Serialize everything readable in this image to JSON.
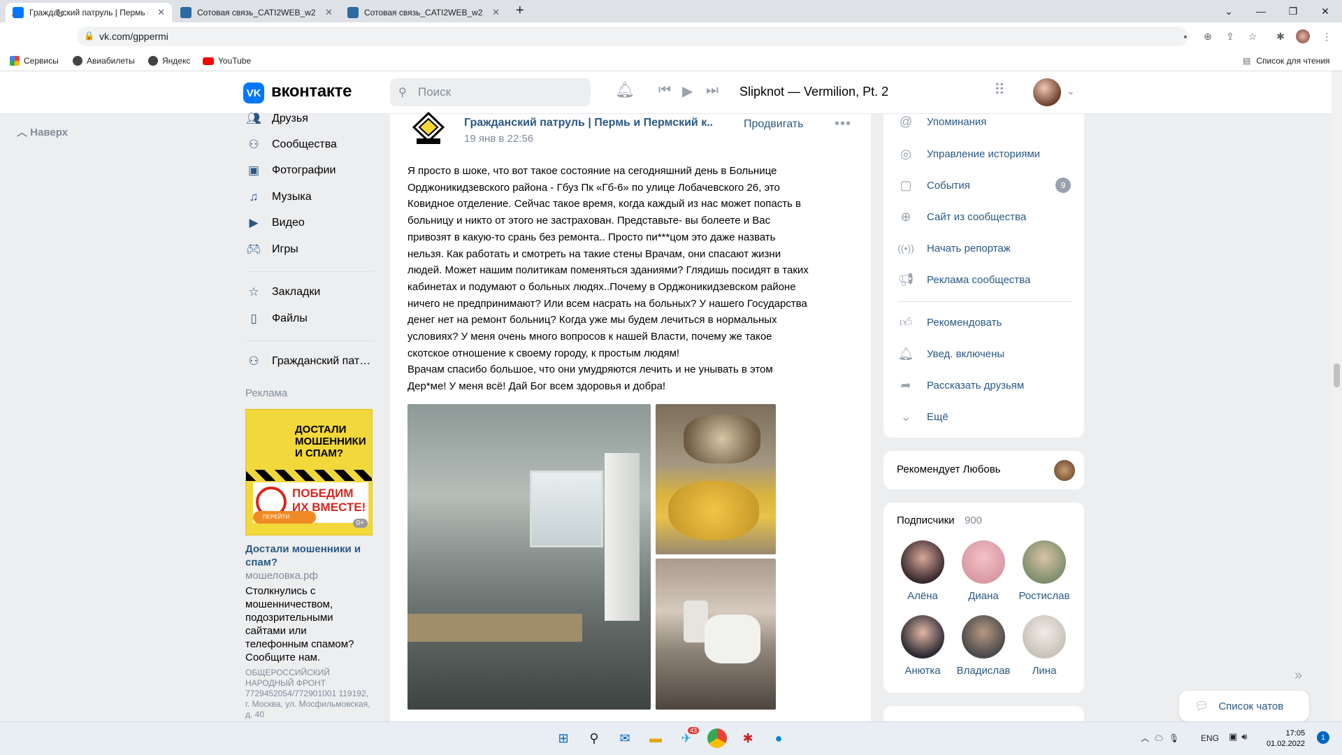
{
  "browser": {
    "tabs": [
      {
        "label": "Гражданский патруль | Пермь и",
        "active": true,
        "favicon_color": "#0077ff"
      },
      {
        "label": "Сотовая связь_CATI2WEB_w2",
        "active": false,
        "favicon_color": "#2d6a9f"
      },
      {
        "label": "Сотовая связь_CATI2WEB_w2",
        "active": false,
        "favicon_color": "#2d6a9f"
      }
    ],
    "new_tab": "+",
    "window_controls": {
      "dropdown": "⌄",
      "minimize": "—",
      "maximize": "❐",
      "close": "✕"
    },
    "url": "vk.com/gppermi",
    "bookmarks": [
      {
        "label": "Сервисы"
      },
      {
        "label": "Авиабилеты"
      },
      {
        "label": "Яндекс"
      },
      {
        "label": "YouTube"
      }
    ],
    "reading_list": "Список для чтения"
  },
  "vk_header": {
    "logo": "VK",
    "brand": "вконтакте",
    "search_placeholder": "Поиск",
    "now_playing": "Slipknot — Vermilion, Pt. 2"
  },
  "left": {
    "back_to_top": "Наверх",
    "menu": [
      {
        "label": "Друзья",
        "icon": "friends-icon"
      },
      {
        "label": "Сообщества",
        "icon": "communities-icon"
      },
      {
        "label": "Фотографии",
        "icon": "photos-icon"
      },
      {
        "label": "Музыка",
        "icon": "music-icon"
      },
      {
        "label": "Видео",
        "icon": "video-icon"
      },
      {
        "label": "Игры",
        "icon": "games-icon"
      }
    ],
    "menu2": [
      {
        "label": "Закладки",
        "icon": "bookmarks-icon"
      },
      {
        "label": "Файлы",
        "icon": "files-icon"
      }
    ],
    "menu3": [
      {
        "label": "Гражданский пат…",
        "icon": "group-icon"
      }
    ],
    "ad": {
      "label": "Реклама",
      "banner_line1": "ДОСТАЛИ МОШЕННИКИ И СПАМ?",
      "banner_line2": "ПОБЕДИМ ИХ ВМЕСТЕ!",
      "banner_button": "ПЕРЕЙТИ",
      "banner_age": "0+",
      "title": "Достали мошенники и спам?",
      "domain": "мошеловка.рф",
      "text": "Столкнулись с мошенничеством, подозрительными сайтами или телефонным спамом? Сообщите нам.",
      "fine_print": "ОБЩЕРОССИЙСКИЙ НАРОДНЫЙ ФРОНТ 7729452054/772901001 119192, г. Москва, ул. Мосфильмовская, д. 40"
    }
  },
  "post": {
    "group_name": "Гражданский патруль | Пермь и Пермский к...",
    "date": "19 янв в 22:56",
    "promote": "Продвигать",
    "more": "•••",
    "text": "Я просто в шоке, что вот такое состояние на сегодняшний день в Больнице\nОрджоникидзевского района - Гбуз Пк «Гб-6» по улице Лобачевского 26, это\nКовидное отделение. Сейчас такое время, когда каждый из нас может попасть в\nбольницу и никто от этого не застрахован. Представьте- вы болеете и Вас\nпривозят в какую-то срань без ремонта.. Просто пи***цом это даже назвать\nнельзя. Как работать и смотреть на такие стены Врачам, они спасают жизни\nлюдей. Может нашим политикам поменяться зданиями? Глядишь посидят в таких\nкабинетах и подумают о больных людях..Почему в Орджоникидзевском районе\nничего не предпринимают? Или всем насрать на больных? У нашего Государства\nденег нет на ремонт больниц? Когда уже мы будем лечиться в нормальных\nусловиях? У меня очень много вопросов к нашей Власти, почему же такое\nскотское отношение к своему городу, к простым людям!\nВрачам спасибо большое, что они умудряются лечить и не унывать в этом\nДер*ме! У меня всё! Дай Бог всем здоровья и добра!"
  },
  "right": {
    "actions": [
      {
        "label": "Упоминания",
        "icon": "mention-icon"
      },
      {
        "label": "Управление историями",
        "icon": "stories-icon"
      },
      {
        "label": "События",
        "icon": "events-icon",
        "badge": "9"
      },
      {
        "label": "Сайт из сообщества",
        "icon": "globe-icon"
      },
      {
        "label": "Начать репортаж",
        "icon": "broadcast-icon"
      },
      {
        "label": "Реклама сообщества",
        "icon": "megaphone-icon"
      }
    ],
    "actions2": [
      {
        "label": "Рекомендовать",
        "icon": "thumb-up-icon"
      },
      {
        "label": "Увед. включены",
        "icon": "bell-check-icon"
      },
      {
        "label": "Рассказать друзьям",
        "icon": "share-icon"
      },
      {
        "label": "Ещё",
        "icon": "chevron-down-icon"
      }
    ],
    "recommends": "Рекомендует Любовь",
    "subscribers_label": "Подписчики",
    "subscribers_count": "900",
    "subscribers": [
      {
        "name": "Алёна",
        "color": "#3a2a2f"
      },
      {
        "name": "Диана",
        "color": "#d99aa4"
      },
      {
        "name": "Ростислав",
        "color": "#7e8f6d"
      },
      {
        "name": "Анютка",
        "color": "#2b2b33"
      },
      {
        "name": "Владислав",
        "color": "#4a4a4a"
      },
      {
        "name": "Лина",
        "color": "#c9c2ba"
      }
    ],
    "chats": "Список чатов"
  },
  "taskbar": {
    "lang": "ENG",
    "time": "17:05",
    "date": "01.02.2022",
    "notifications": "1",
    "telegram_badge": "43"
  }
}
